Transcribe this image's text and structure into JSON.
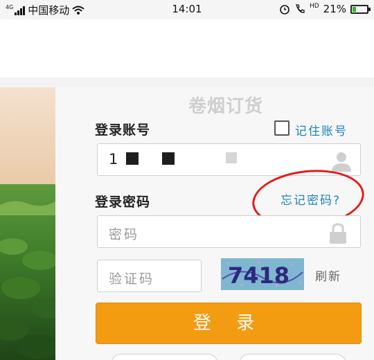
{
  "status_bar": {
    "network_tag": "4G",
    "carrier": "中国移动",
    "time": "14:01",
    "hd_tag": "HD",
    "battery_percent": "21%",
    "battery_level": 0.21,
    "icons": [
      "signal-icon",
      "wifi-icon",
      "alarm-icon",
      "call-icon",
      "battery-icon"
    ]
  },
  "login": {
    "title": "卷烟订货",
    "account_label": "登录账号",
    "remember_label": "记住账号",
    "remember_checked": false,
    "account_value": "1",
    "password_label": "登录密码",
    "forgot_link": "忘记密码?",
    "password_placeholder": "密码",
    "captcha_placeholder": "验证码",
    "captcha_text": "7418",
    "refresh_label": "刷新",
    "login_button": "登 录"
  },
  "colors": {
    "accent_orange": "#f39c12",
    "link_blue": "#1d84b5",
    "annotation_red": "#e61a1a"
  }
}
